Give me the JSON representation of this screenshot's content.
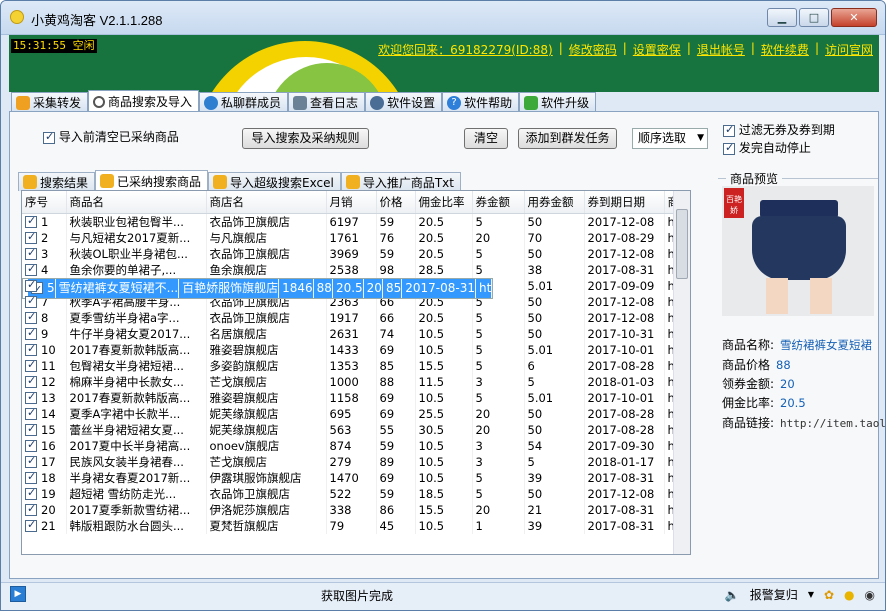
{
  "window": {
    "title": "小黄鸡淘客 V2.1.1.288"
  },
  "banner": {
    "clock": "15:31:55 空闲",
    "links": [
      "欢迎您回来：69182279(ID:88)",
      "修改密码",
      "设置密保",
      "退出帐号",
      "软件续费",
      "访问官网"
    ]
  },
  "main_tabs": [
    "采集转发",
    "商品搜索及导入",
    "私聊群成员",
    "查看日志",
    "软件设置",
    "软件帮助",
    "软件升级"
  ],
  "toolbar": {
    "clear_before_import": "导入前清空已采纳商品",
    "import_rule_button": "导入搜索及采纳规则",
    "clear_button": "清空",
    "add_task_button": "添加到群发任务",
    "order_select": "顺序选取",
    "filter_no_coupon": "过滤无券及券到期",
    "auto_stop": "发完自动停止"
  },
  "sub_tabs": [
    "搜索结果",
    "已采纳搜索商品",
    "导入超级搜索Excel",
    "导入推广商品Txt"
  ],
  "table": {
    "columns": [
      "序号",
      "商品名",
      "商店名",
      "月销",
      "价格",
      "佣金比率",
      "券金额",
      "用券金额",
      "券到期日期",
      "商"
    ],
    "rows": [
      [
        "1",
        "秋装职业包裙包臀半...",
        "衣品饰卫旗舰店",
        "6197",
        "59",
        "20.5",
        "5",
        "50",
        "2017-12-08",
        "ht"
      ],
      [
        "2",
        "与凡短裙女2017夏新...",
        "与凡旗舰店",
        "1761",
        "76",
        "20.5",
        "20",
        "70",
        "2017-08-29",
        "ht"
      ],
      [
        "3",
        "秋装OL职业半身裙包...",
        "衣品饰卫旗舰店",
        "3969",
        "59",
        "20.5",
        "5",
        "50",
        "2017-12-08",
        "ht"
      ],
      [
        "4",
        "鱼余你要的单裙子,...",
        "鱼余旗舰店",
        "2538",
        "98",
        "28.5",
        "5",
        "38",
        "2017-08-31",
        "ht"
      ],
      [
        "5",
        "雪纺裙裤女夏短裙不...",
        "百艳娇服饰旗舰店",
        "1846",
        "88",
        "20.5",
        "20",
        "85",
        "2017-08-31",
        "ht"
      ],
      [
        "6",
        "迪恣2017夏季新款韩...",
        "迪恣旗舰店",
        "1943",
        "57",
        "10.5",
        "5",
        "5.01",
        "2017-09-09",
        "ht"
      ],
      [
        "7",
        "秋季A字裙高腰半身...",
        "衣品饰卫旗舰店",
        "2363",
        "66",
        "20.5",
        "5",
        "50",
        "2017-12-08",
        "ht"
      ],
      [
        "8",
        "夏季雪纺半身裙a字...",
        "衣品饰卫旗舰店",
        "1917",
        "66",
        "20.5",
        "5",
        "50",
        "2017-12-08",
        "ht"
      ],
      [
        "9",
        "牛仔半身裙女夏2017...",
        "名居旗舰店",
        "2631",
        "74",
        "10.5",
        "5",
        "50",
        "2017-10-31",
        "ht"
      ],
      [
        "10",
        "2017春夏新款韩版高...",
        "雅姿碧旗舰店",
        "1433",
        "69",
        "10.5",
        "5",
        "5.01",
        "2017-10-01",
        "ht"
      ],
      [
        "11",
        "包臀裙女半身裙短裙...",
        "多姿韵旗舰店",
        "1353",
        "85",
        "15.5",
        "5",
        "6",
        "2017-08-28",
        "ht"
      ],
      [
        "12",
        "棉麻半身裙中长款女...",
        "芒戈旗舰店",
        "1000",
        "88",
        "11.5",
        "3",
        "5",
        "2018-01-03",
        "ht"
      ],
      [
        "13",
        "2017春夏新款韩版高...",
        "雅姿碧旗舰店",
        "1158",
        "69",
        "10.5",
        "5",
        "5.01",
        "2017-10-01",
        "ht"
      ],
      [
        "14",
        "夏季A字裙中长款半...",
        "妮芙缘旗舰店",
        "695",
        "69",
        "25.5",
        "20",
        "50",
        "2017-08-28",
        "ht"
      ],
      [
        "15",
        "蕾丝半身裙短裙女夏...",
        "妮芙缘旗舰店",
        "563",
        "55",
        "30.5",
        "20",
        "50",
        "2017-08-28",
        "ht"
      ],
      [
        "16",
        "2017夏中长半身裙高...",
        "onoev旗舰店",
        "874",
        "59",
        "10.5",
        "3",
        "54",
        "2017-09-30",
        "ht"
      ],
      [
        "17",
        "民族风女装半身裙春...",
        "芒戈旗舰店",
        "279",
        "89",
        "10.5",
        "3",
        "5",
        "2018-01-17",
        "ht"
      ],
      [
        "18",
        "半身裙女春夏2017新...",
        "伊露琪服饰旗舰店",
        "1470",
        "69",
        "10.5",
        "5",
        "39",
        "2017-08-31",
        "ht"
      ],
      [
        "19",
        "超短裙 雪纺防走光...",
        "衣品饰卫旗舰店",
        "522",
        "59",
        "18.5",
        "5",
        "50",
        "2017-12-08",
        "ht"
      ],
      [
        "20",
        "2017夏季新款雪纺裙...",
        "伊洛妮莎旗舰店",
        "338",
        "86",
        "15.5",
        "20",
        "21",
        "2017-08-31",
        "ht"
      ],
      [
        "21",
        "韩版粗跟防水台圆头...",
        "夏梵哲旗舰店",
        "79",
        "45",
        "10.5",
        "1",
        "39",
        "2017-08-31",
        "ht"
      ]
    ]
  },
  "preview": {
    "title": "商品预览",
    "tag": "百艳娇",
    "fields": [
      {
        "label": "商品名称:",
        "value": "雪纺裙裤女夏短裙"
      },
      {
        "label": "商品价格",
        "value": "88"
      },
      {
        "label": "领券金额:",
        "value": "20"
      },
      {
        "label": "佣金比率:",
        "value": "20.5"
      },
      {
        "label": "商品链接:",
        "value": "http://item.taol"
      }
    ]
  },
  "status": {
    "text": "获取图片完成",
    "tray_alarm": "报警复归"
  }
}
